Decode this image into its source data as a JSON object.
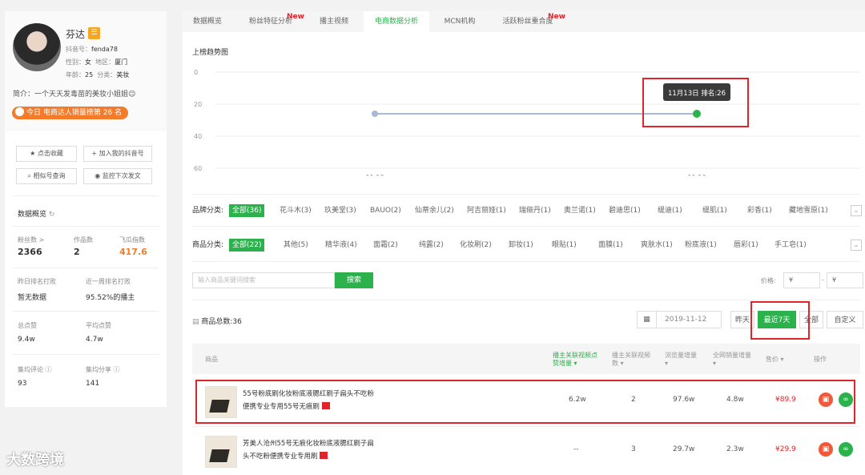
{
  "profile": {
    "name": "芬达",
    "badge": "☰",
    "douyin_id_label": "抖音号：",
    "douyin_id": "fenda78",
    "gender_label": "性别：",
    "gender": "女",
    "region_label": "地区：",
    "region": "厦门",
    "age_label": "年龄：",
    "age": "25",
    "category_label": "分类：",
    "category": "美妆",
    "intro": "简介：一个天天发毒苗的美妆小姐姐😉",
    "rank_pill": "今日 电商达人销量榜第 26 名",
    "buttons": [
      "点击收藏",
      "加入我的抖音号",
      "相似号查询",
      "监控下次发文"
    ]
  },
  "overview": {
    "title": "数据概览",
    "fans_label": "粉丝数 >",
    "fans": "2366",
    "works_label": "作品数",
    "works": "2",
    "index_label": "飞瓜指数",
    "index": "417.6",
    "yesterday_rank_label": "昨日排名打败",
    "yesterday_rank": "暂无数据",
    "week_rank_label": "近一周排名打败",
    "week_rank": "95.52%的播主",
    "likes_label": "总点赞",
    "likes": "9.4w",
    "avg_likes_label": "平均点赞",
    "avg_likes": "4.7w",
    "avg_comments_label": "集均评论 ⓘ",
    "avg_comments": "93",
    "avg_shares_label": "集均分享 ⓘ",
    "avg_shares": "141"
  },
  "tabs": [
    {
      "label": "数据概览",
      "new": ""
    },
    {
      "label": "粉丝特征分析",
      "new": "New"
    },
    {
      "label": "播主视频",
      "new": ""
    },
    {
      "label": "电商数据分析",
      "new": ""
    },
    {
      "label": "MCN机构",
      "new": ""
    },
    {
      "label": "活跃粉丝重合度",
      "new": "New"
    }
  ],
  "chart_data": {
    "type": "line",
    "title": "上榜趋势图",
    "x": [
      "11.12",
      "11.13"
    ],
    "y_ticks": [
      "0",
      "20",
      "40",
      "60"
    ],
    "ylim": [
      0,
      60
    ],
    "y_inverted": true,
    "series": [
      {
        "values": [
          26,
          26
        ]
      }
    ],
    "tooltip": "11月13日 排名:26",
    "line_color": "#a9b8d8",
    "point_color": "#2bb24c"
  },
  "brand_filter": {
    "label": "品牌分类:",
    "items": [
      "全部(36)",
      "花斗木(3)",
      "玖美堂(3)",
      "BAUO(2)",
      "仙蒂余儿(2)",
      "阿吉丽娅(1)",
      "瑞俪丹(1)",
      "奥兰诺(1)",
      "碧迪思(1)",
      "缇迪(1)",
      "缇肌(1)",
      "彩香(1)",
      "藏地雪原(1)"
    ]
  },
  "product_filter": {
    "label": "商品分类:",
    "items": [
      "全部(22)",
      "其他(5)",
      "精华液(4)",
      "面霜(2)",
      "纯露(2)",
      "化妆刷(2)",
      "卸妆(1)",
      "眼贴(1)",
      "面膜(1)",
      "爽肤水(1)",
      "粉底液(1)",
      "唇彩(1)",
      "手工皂(1)"
    ]
  },
  "search": {
    "placeholder": "输入商品关键词搜索",
    "button": "搜索",
    "price_label": "价格:",
    "price_min": "¥",
    "price_sep": "-",
    "price_max": "¥"
  },
  "toolbar": {
    "total": "商品总数:36",
    "date": "2019-11-12",
    "ranges": [
      "昨天",
      "最近7天",
      "全部",
      "自定义"
    ]
  },
  "table": {
    "headers": [
      "商品",
      "播主关联视频点赞增量",
      "播主关联视频数",
      "浏览量增量",
      "全网销量增量",
      "售价",
      "操作"
    ],
    "rows": [
      {
        "name": "55号粉底刷化妆粉底液腮红刷子扁头不吃粉便携专业专用55号无痕刷",
        "likes": "6.2w",
        "videos": "2",
        "views": "97.6w",
        "sales": "4.8w",
        "price": "¥89.9"
      },
      {
        "name": "芳美人沧州55号无痕化妆粉底液腮红刷子扁头不吃粉便携专业专用刷",
        "likes": "--",
        "videos": "3",
        "views": "29.7w",
        "sales": "2.3w",
        "price": "¥29.9"
      }
    ]
  },
  "watermark": "大数跨境"
}
